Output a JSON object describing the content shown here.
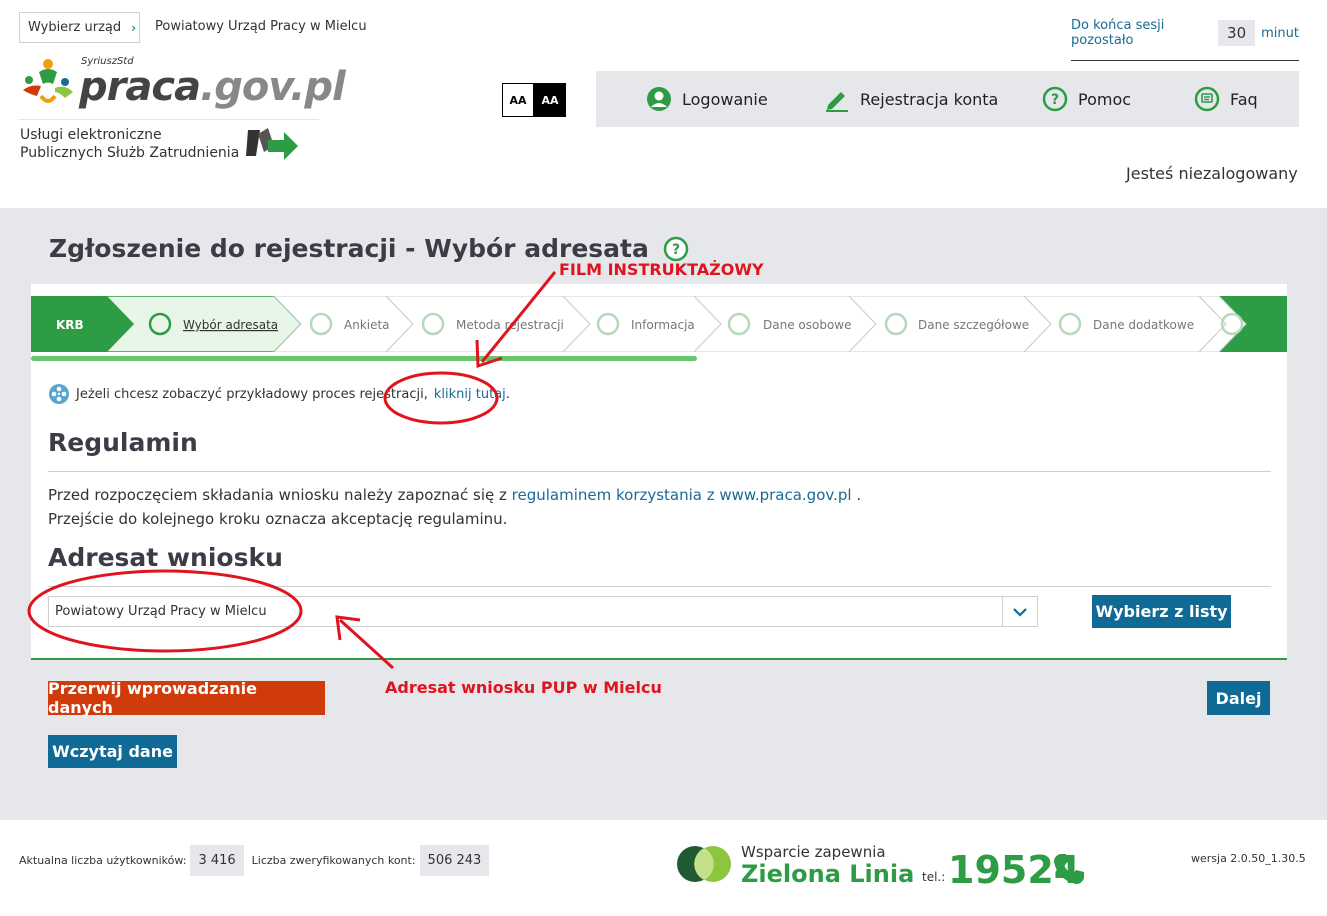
{
  "header": {
    "office_button": "Wybierz urząd",
    "office_name": "Powiatowy Urząd Pracy w Mielcu",
    "logo_small": "SyriuszStd",
    "logo_main": "praca",
    "logo_domain": ".gov.pl",
    "subtitle_line1": "Usługi elektroniczne",
    "subtitle_line2": "Publicznych Służb Zatrudnienia",
    "session_label": "Do końca sesji pozostało",
    "session_value": "30",
    "session_unit": "minut",
    "contrast_normal": "AA",
    "contrast_high": "AA",
    "not_logged": "Jesteś niezalogowany"
  },
  "topnav": {
    "items": [
      {
        "label": "Logowanie",
        "icon": "user-circle-icon"
      },
      {
        "label": "Rejestracja konta",
        "icon": "pencil-icon"
      },
      {
        "label": "Pomoc",
        "icon": "question-circle-icon"
      },
      {
        "label": "Faq",
        "icon": "chat-icon"
      }
    ]
  },
  "page": {
    "title": "Zgłoszenie do rejestracji - Wybór adresata",
    "steps": [
      {
        "label": "KRB",
        "state": "done"
      },
      {
        "label": "Wybór adresata",
        "state": "active"
      },
      {
        "label": "Ankieta",
        "state": "pending"
      },
      {
        "label": "Metoda rejestracji",
        "state": "pending"
      },
      {
        "label": "Informacja",
        "state": "pending"
      },
      {
        "label": "Dane osobowe",
        "state": "pending"
      },
      {
        "label": "Dane szczegółowe",
        "state": "pending"
      },
      {
        "label": "Dane dodatkowe",
        "state": "pending"
      }
    ],
    "progress_fraction": 0.53,
    "film_text": "Jeżeli chcesz zobaczyć przykładowy proces rejestracji,",
    "film_link": "kliknij tutaj",
    "film_end": ".",
    "regulamin_heading": "Regulamin",
    "regulamin_text1": "Przed rozpoczęciem składania wniosku należy zapoznać się z",
    "regulamin_link": "regulaminem korzystania z www.praca.gov.pl",
    "regulamin_text1_end": ".",
    "regulamin_text2": "Przejście do kolejnego kroku oznacza akceptację regulaminu.",
    "adresat_heading": "Adresat wniosku",
    "adresat_value": "Powiatowy Urząd Pracy w Mielcu",
    "btn_lista": "Wybierz z listy",
    "btn_przerwij": "Przerwij wprowadzanie danych",
    "btn_dalej": "Dalej",
    "btn_wczytaj": "Wczytaj dane"
  },
  "annotations": {
    "film": "FILM INSTRUKTAŻOWY",
    "adresat": "Adresat wniosku PUP w Mielcu"
  },
  "footer": {
    "users_label": "Aktualna liczba użytkowników:",
    "users_value": "3 416",
    "verified_label": "Liczba zweryfikowanych kont:",
    "verified_value": "506 243",
    "zl_line1": "Wsparcie zapewnia",
    "zl_line2": "Zielona Linia",
    "tel_label": "tel.:",
    "tel_number": "19524",
    "version": "wersja 2.0.50_1.30.5"
  },
  "colors": {
    "green": "#2e9b45",
    "blue": "#0f6a96",
    "red_button": "#d03b0b",
    "annotation_red": "#e0141e",
    "grey_bg": "#e6e7ea"
  }
}
